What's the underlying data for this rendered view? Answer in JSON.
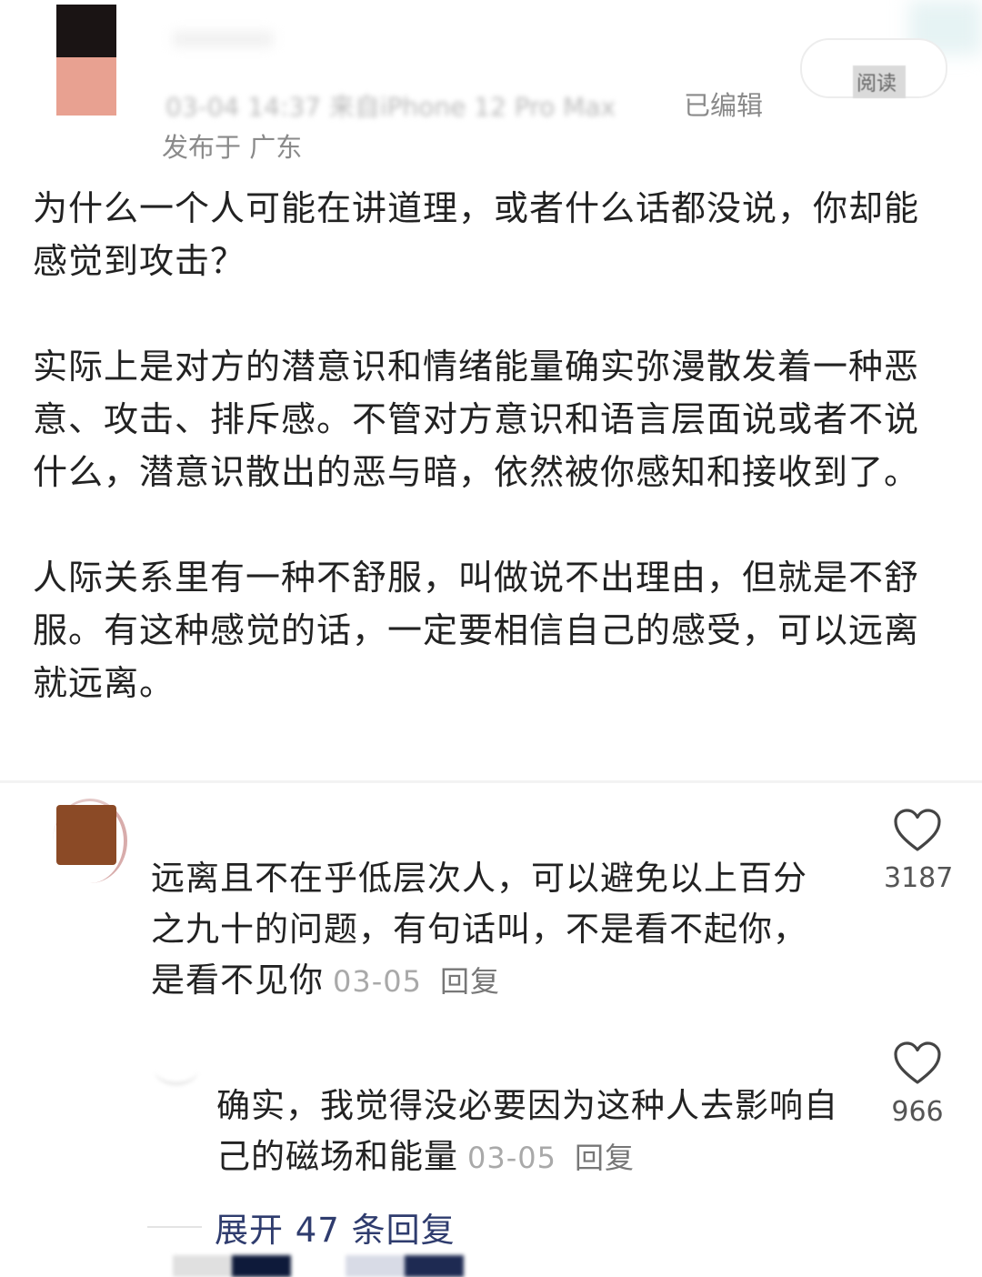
{
  "header": {
    "read_button_label": "阅读",
    "meta_line": "03-04 14:37 来自iPhone 12 Pro Max",
    "edited_label": "已编辑",
    "published_location": "发布于 广东"
  },
  "post": {
    "paragraphs": [
      "为什么一个人可能在讲道理，或者什么话都没说，你却能感觉到攻击？",
      "实际上是对方的潜意识和情绪能量确实弥漫散发着一种恶意、攻击、排斥感。不管对方意识和语言层面说或者不说什么，潜意识散出的恶与暗，依然被你感知和接收到了。",
      "人际关系里有一种不舒服，叫做说不出理由，但就是不舒服。有这种感觉的话，一定要相信自己的感受，可以远离就远离。"
    ]
  },
  "comment": {
    "text": "远离且不在乎低层次人，可以避免以上百分之九十的问题，有句话叫，不是看不起你，是看不见你",
    "date": "03-05",
    "reply_label": "回复",
    "likes": "3187",
    "like_icon": "heart-outline-icon"
  },
  "reply": {
    "text": "确实，我觉得没必要因为这种人去影响自己的磁场和能量",
    "date": "03-05",
    "reply_label": "回复",
    "likes": "966",
    "like_icon": "heart-outline-icon"
  },
  "expand_label": "展开 47 条回复",
  "colors": {
    "link": "#2f3c6e",
    "meta": "#8a8a8a",
    "date": "#a9a9a9"
  }
}
